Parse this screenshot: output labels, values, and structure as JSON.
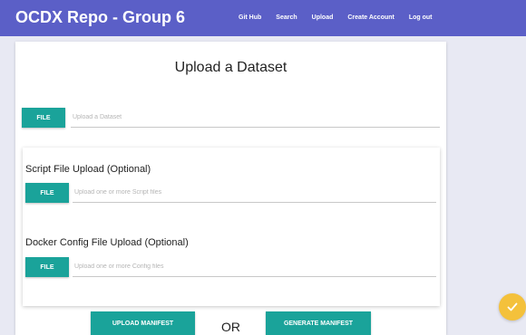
{
  "navbar": {
    "brand": "OCDX Repo - Group 6",
    "links": [
      "Git Hub",
      "Search",
      "Upload",
      "Create Account",
      "Log out"
    ]
  },
  "main": {
    "title": "Upload a Dataset",
    "dataset_upload": {
      "button_label": "FILE",
      "placeholder": "Upload a Dataset"
    },
    "script_upload": {
      "section_label": "Script File Upload (Optional)",
      "button_label": "FILE",
      "placeholder": "Upload one or more Script files"
    },
    "docker_upload": {
      "section_label": "Docker Config File Upload (Optional)",
      "button_label": "FILE",
      "placeholder": "Upload one or more Config files"
    },
    "upload_manifest_label": "UPLOAD MANIFEST",
    "or_label": "OR",
    "generate_manifest_label": "GENERATE MANIFEST"
  },
  "colors": {
    "navbar": "#5b5fc7",
    "accent": "#1aa39a",
    "fab": "#f4c13b",
    "background": "#e8e9f3"
  },
  "icons": {
    "fab": "check-icon"
  }
}
